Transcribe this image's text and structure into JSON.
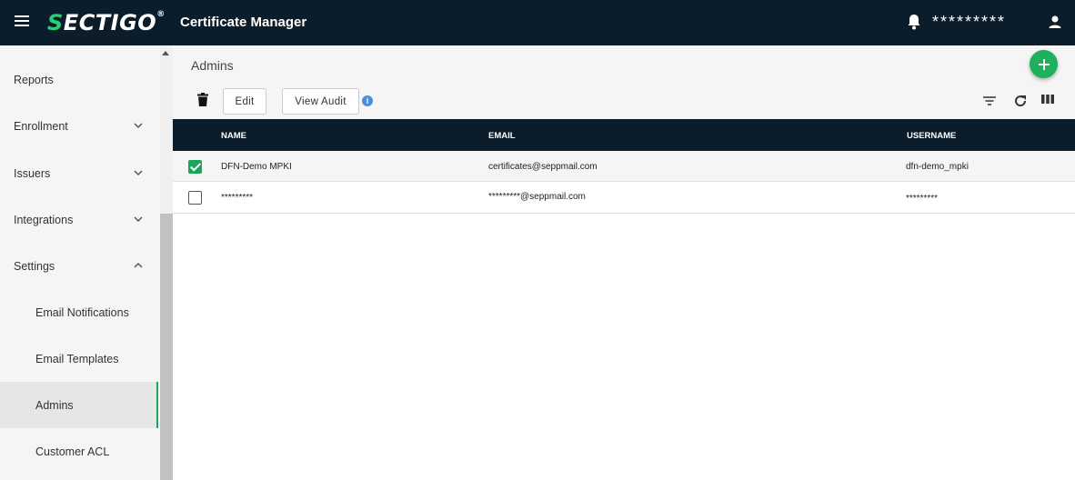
{
  "header": {
    "logo_text": "SECTIGO",
    "app_title": "Certificate Manager",
    "username": "*********"
  },
  "sidebar": {
    "items": [
      {
        "label": "Reports"
      },
      {
        "label": "Enrollment"
      },
      {
        "label": "Issuers"
      },
      {
        "label": "Integrations"
      },
      {
        "label": "Settings"
      },
      {
        "label": "Email Notifications"
      },
      {
        "label": "Email Templates"
      },
      {
        "label": "Admins"
      },
      {
        "label": "Customer ACL"
      }
    ]
  },
  "main": {
    "page_title": "Admins",
    "buttons": {
      "edit": "Edit",
      "view_audit": "View Audit"
    },
    "table": {
      "columns": [
        "NAME",
        "EMAIL",
        "USERNAME"
      ],
      "rows": [
        {
          "checked": true,
          "name": "DFN-Demo MPKI",
          "email": "certificates@seppmail.com",
          "username": "dfn-demo_mpki"
        },
        {
          "checked": false,
          "name": "*********",
          "email": "*********@seppmail.com",
          "username": "*********"
        }
      ]
    }
  },
  "colors": {
    "header_bg": "#0b1d2a",
    "accent_green": "#1ea35a",
    "add_button": "#1fb05e",
    "info_blue": "#4a90d9"
  }
}
